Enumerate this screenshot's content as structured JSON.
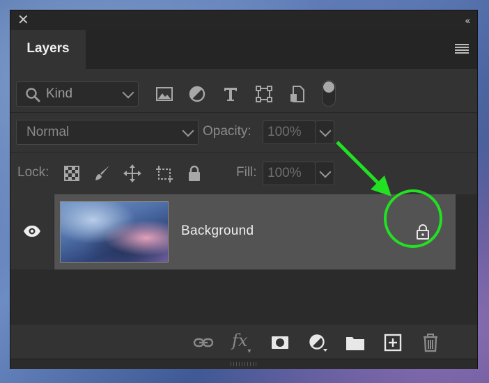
{
  "panel": {
    "tab_label": "Layers",
    "close_glyph": "✕",
    "collapse_glyph": "‹‹"
  },
  "filter": {
    "kind_label": "Kind",
    "icons": [
      "image-filter-icon",
      "adjustment-filter-icon",
      "type-filter-icon",
      "shape-filter-icon",
      "smart-object-filter-icon"
    ]
  },
  "blend": {
    "mode": "Normal",
    "opacity_label": "Opacity:",
    "opacity_value": "100%"
  },
  "lock": {
    "label": "Lock:",
    "fill_label": "Fill:",
    "fill_value": "100%",
    "icons": [
      "lock-transparent-pixels-icon",
      "lock-image-pixels-icon",
      "lock-position-icon",
      "lock-artboard-icon",
      "lock-all-icon"
    ]
  },
  "layers": [
    {
      "name": "Background",
      "visible": true,
      "locked": true
    }
  ],
  "footer": {
    "fx_label": "fx",
    "icons": [
      "link-layers-icon",
      "fx-icon",
      "add-mask-icon",
      "new-adjustment-icon",
      "new-group-icon",
      "new-layer-icon",
      "delete-layer-icon"
    ]
  },
  "annotation": {
    "color": "#22e022"
  }
}
